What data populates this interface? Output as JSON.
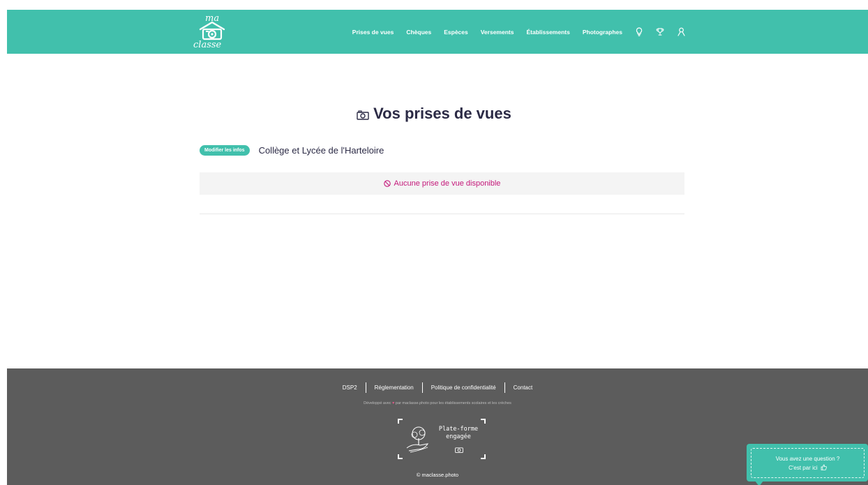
{
  "header": {
    "logo": {
      "top_text": "ma",
      "bottom_text": "classe"
    },
    "nav": [
      {
        "label": "Prises de vues"
      },
      {
        "label": "Chèques"
      },
      {
        "label": "Espèces"
      },
      {
        "label": "Versements"
      },
      {
        "label": "Établissements"
      },
      {
        "label": "Photographes"
      }
    ],
    "icons": [
      "lightbulb-icon",
      "trophy-icon",
      "user-icon"
    ]
  },
  "main": {
    "title": "Vos prises de vues",
    "title_icon": "camera-icon",
    "edit_button": "Modifier les infos",
    "school_name": "Collège et Lycée de l'Harteloire",
    "empty_message": "Aucune prise de vue disponible",
    "empty_icon": "forbidden-icon"
  },
  "footer": {
    "links": [
      "DSP2",
      "Réglementation",
      "Politique de confidentialité",
      "Contact"
    ],
    "dev_before": "Développé avec",
    "dev_after": "par maclasse.photo pour les établissements scolaires et les crèches",
    "badge_line1": "Plate-forme",
    "badge_line2": "engagée",
    "copyright": "© maclasse.photo"
  },
  "help": {
    "line1": "Vous avez une question ?",
    "line2": "C'est par ici"
  },
  "colors": {
    "brand": "#41c0ac",
    "title": "#2b2a45",
    "empty_text": "#c4187a",
    "footer_bg": "#5c5c5c"
  }
}
